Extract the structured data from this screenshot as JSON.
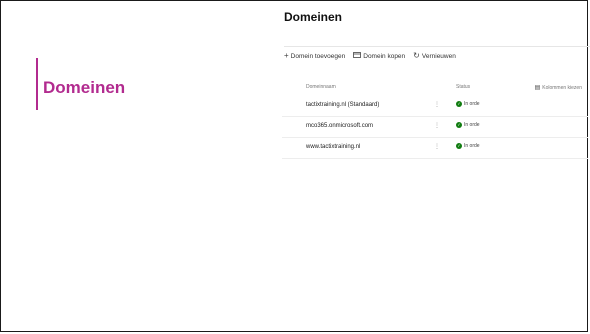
{
  "sidebar": {
    "title": "Domeinen"
  },
  "main": {
    "title": "Domeinen"
  },
  "toolbar": {
    "add_label": "Domein toevoegen",
    "buy_label": "Domein kopen",
    "refresh_label": "Vernieuwen"
  },
  "table": {
    "headers": {
      "name": "Domeinnaam",
      "status": "Status",
      "columns": "Kolommen kiezen"
    },
    "rows": [
      {
        "name": "tactixtraining.nl (Standaard)",
        "status": "In orde"
      },
      {
        "name": "mco365.onmicrosoft.com",
        "status": "In orde"
      },
      {
        "name": "www.tactixtraining.nl",
        "status": "In orde"
      }
    ]
  },
  "colors": {
    "accent": "#b22b8f",
    "ok": "#107c10"
  },
  "icons": {
    "add": "plus-icon",
    "buy": "card-icon",
    "refresh": "refresh-icon",
    "status_ok": "checkmark-icon",
    "columns": "columns-icon",
    "more": "more-icon"
  }
}
